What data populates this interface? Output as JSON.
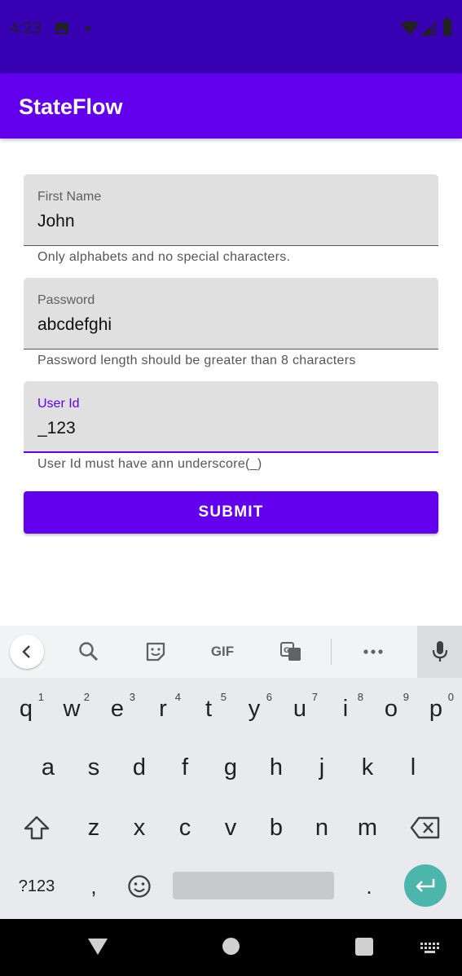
{
  "status_bar": {
    "time": "4:23",
    "icons": [
      "image-icon",
      "notification-dot-icon",
      "wifi-icon",
      "signal-icon",
      "battery-icon"
    ]
  },
  "app_bar": {
    "title": "StateFlow"
  },
  "form": {
    "first_name": {
      "label": "First Name",
      "value": "John",
      "helper": "Only alphabets and no special characters."
    },
    "password": {
      "label": "Password",
      "value": "abcdefghi",
      "helper": "Password length should be greater than 8 characters"
    },
    "user_id": {
      "label": "User Id",
      "value": "_123",
      "helper": "User Id must have ann underscore(_)"
    },
    "submit_label": "SUBMIT"
  },
  "keyboard": {
    "toolbar": {
      "gif_label": "GIF"
    },
    "row1": [
      {
        "key": "q",
        "hint": "1"
      },
      {
        "key": "w",
        "hint": "2"
      },
      {
        "key": "e",
        "hint": "3"
      },
      {
        "key": "r",
        "hint": "4"
      },
      {
        "key": "t",
        "hint": "5"
      },
      {
        "key": "y",
        "hint": "6"
      },
      {
        "key": "u",
        "hint": "7"
      },
      {
        "key": "i",
        "hint": "8"
      },
      {
        "key": "o",
        "hint": "9"
      },
      {
        "key": "p",
        "hint": "0"
      }
    ],
    "row2": [
      "a",
      "s",
      "d",
      "f",
      "g",
      "h",
      "j",
      "k",
      "l"
    ],
    "row3": [
      "z",
      "x",
      "c",
      "v",
      "b",
      "n",
      "m"
    ],
    "symbols_label": "?123",
    "comma": ",",
    "period": "."
  },
  "colors": {
    "status_bar": "#3700B3",
    "primary": "#6200EE",
    "field_bg": "#E0E0E0",
    "enter_key": "#4DB6AC"
  }
}
